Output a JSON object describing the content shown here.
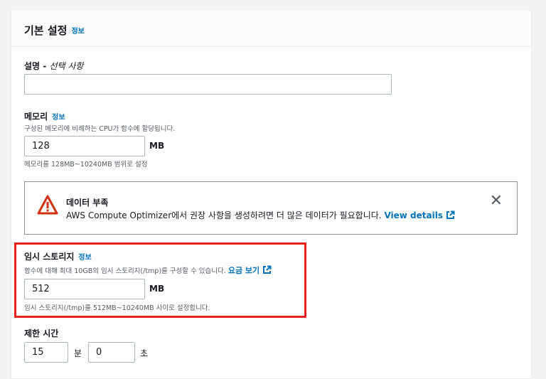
{
  "header": {
    "title": "기본 설정",
    "info": "정보"
  },
  "description": {
    "label": "설명 - ",
    "label_optional": "선택 사항",
    "value": ""
  },
  "memory": {
    "label": "메모리",
    "info": "정보",
    "description": "구성된 메모리에 비례하는 CPU가 함수에 할당됩니다.",
    "value": "128",
    "unit": "MB",
    "constraint": "메모리를 128MB~10240MB 범위로 설정"
  },
  "alert": {
    "title": "데이터 부족",
    "body": "AWS Compute Optimizer에서 권장 사항을 생성하려면 더 많은 데이터가 필요합니다.",
    "link": "View details"
  },
  "storage": {
    "label": "임시 스토리지",
    "info": "정보",
    "description": "함수에 대해 최대 10GB의 임시 스토리지(/tmp)를 구성할 수 있습니다.",
    "link": "요금 보기",
    "value": "512",
    "unit": "MB",
    "constraint": "임시 스토리지(/tmp)를 512MB~10240MB 사이로 설정합니다."
  },
  "timeout": {
    "label": "제한 시간",
    "minutes": "15",
    "minutes_unit": "분",
    "seconds": "0",
    "seconds_unit": "초"
  },
  "colors": {
    "accent": "#0073bb",
    "highlight": "#e8221b",
    "warning": "#d13212"
  }
}
